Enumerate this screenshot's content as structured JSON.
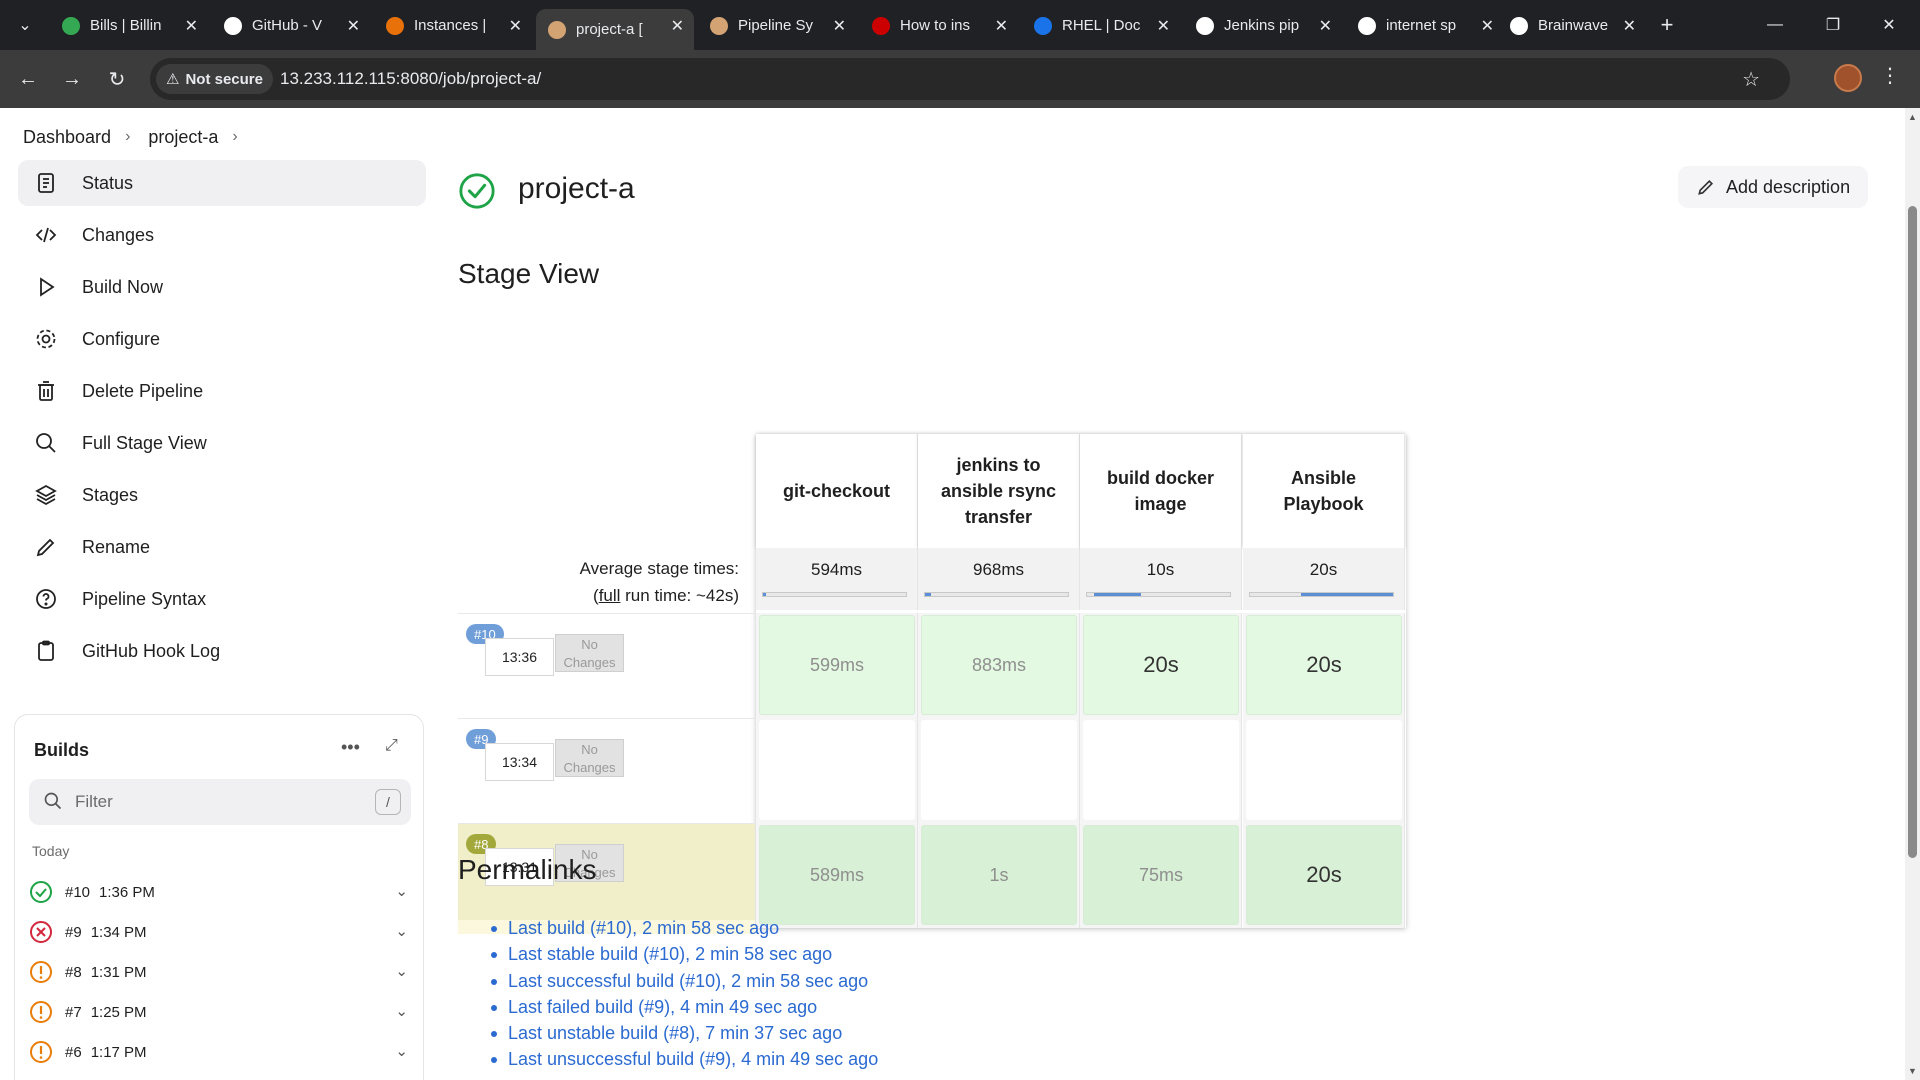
{
  "browser": {
    "tabs": [
      {
        "label": "Bills | Billin",
        "icon": "bills-favicon",
        "color": "#34a853"
      },
      {
        "label": "GitHub - V",
        "icon": "github-favicon",
        "color": "#ffffff"
      },
      {
        "label": "Instances |",
        "icon": "aws-favicon",
        "color": "#e8710a"
      },
      {
        "label": "project-a [",
        "icon": "jenkins-favicon",
        "color": "#d4a373"
      },
      {
        "label": "Pipeline Sy",
        "icon": "jenkins-favicon",
        "color": "#d4a373"
      },
      {
        "label": "How to ins",
        "icon": "redhat-favicon",
        "color": "#cc0000"
      },
      {
        "label": "RHEL | Doc",
        "icon": "rhel-favicon",
        "color": "#1a73e8"
      },
      {
        "label": "Jenkins pip",
        "icon": "openai-favicon",
        "color": "#ffffff"
      },
      {
        "label": "internet sp",
        "icon": "google-favicon",
        "color": "#ffffff"
      },
      {
        "label": "Brainwave",
        "icon": "brainwave-favicon",
        "color": "#ffffff"
      }
    ],
    "active_tab": 3,
    "security_label": "Not secure",
    "url": "13.233.112.115:8080/job/project-a/"
  },
  "breadcrumb": {
    "items": [
      "Dashboard",
      "project-a"
    ]
  },
  "sidebar": {
    "items": [
      {
        "label": "Status",
        "icon": "status-doc-icon"
      },
      {
        "label": "Changes",
        "icon": "code-icon"
      },
      {
        "label": "Build Now",
        "icon": "play-icon"
      },
      {
        "label": "Configure",
        "icon": "gear-icon"
      },
      {
        "label": "Delete Pipeline",
        "icon": "trash-icon"
      },
      {
        "label": "Full Stage View",
        "icon": "search-icon"
      },
      {
        "label": "Stages",
        "icon": "layers-icon"
      },
      {
        "label": "Rename",
        "icon": "pencil-icon"
      },
      {
        "label": "Pipeline Syntax",
        "icon": "help-circle-icon"
      },
      {
        "label": "GitHub Hook Log",
        "icon": "clipboard-icon"
      }
    ]
  },
  "builds": {
    "title": "Builds",
    "filter_placeholder": "Filter",
    "filter_shortcut": "/",
    "group_label": "Today",
    "list": [
      {
        "number": "#10",
        "time": "1:36 PM",
        "status": "success"
      },
      {
        "number": "#9",
        "time": "1:34 PM",
        "status": "failed"
      },
      {
        "number": "#8",
        "time": "1:31 PM",
        "status": "unstable"
      },
      {
        "number": "#7",
        "time": "1:25 PM",
        "status": "unstable"
      },
      {
        "number": "#6",
        "time": "1:17 PM",
        "status": "unstable"
      }
    ]
  },
  "main": {
    "title": "project-a",
    "add_description": "Add description",
    "stage_view_heading": "Stage View",
    "permalinks_heading": "Permalinks"
  },
  "stage_view": {
    "avg_label_line1": "Average stage times:",
    "avg_label_line2_prefix": "(",
    "avg_label_link": "full",
    "avg_label_line2_suffix": " run time: ~42s)",
    "stages": [
      {
        "name": "git-checkout",
        "avg": "594ms",
        "avg_fraction_start": 0.0,
        "avg_fraction": 0.02
      },
      {
        "name": "jenkins to ansible rsync transfer",
        "avg": "968ms",
        "avg_fraction_start": 0.0,
        "avg_fraction": 0.04
      },
      {
        "name": "build docker image",
        "avg": "10s",
        "avg_fraction_start": 0.05,
        "avg_fraction": 0.33
      },
      {
        "name": "Ansible Playbook",
        "avg": "20s",
        "avg_fraction_start": 0.36,
        "avg_fraction": 0.64
      }
    ],
    "runs": [
      {
        "badge": "#10",
        "badge_color": "#6f9ed8",
        "time": "13:36",
        "changes": "No Changes",
        "highlight": false,
        "cells": [
          {
            "text": "599ms",
            "big": false
          },
          {
            "text": "883ms",
            "big": false
          },
          {
            "text": "20s",
            "big": true
          },
          {
            "text": "20s",
            "big": true
          }
        ],
        "cell_color": "#e4f9e1"
      },
      {
        "badge": "#9",
        "badge_color": "#6f9ed8",
        "time": "13:34",
        "changes": "No Changes",
        "highlight": false,
        "cells": [
          {
            "text": "",
            "big": false
          },
          {
            "text": "",
            "big": false
          },
          {
            "text": "",
            "big": false
          },
          {
            "text": "",
            "big": false
          }
        ],
        "cell_color": "#ffffff"
      },
      {
        "badge": "#8",
        "badge_color": "#a3a83a",
        "time": "13:31",
        "changes": "No Changes",
        "highlight": true,
        "cells": [
          {
            "text": "589ms",
            "big": false
          },
          {
            "text": "1s",
            "big": false
          },
          {
            "text": "75ms",
            "big": false
          },
          {
            "text": "20s",
            "big": true
          }
        ],
        "cell_color": "#d8f0d5"
      }
    ]
  },
  "permalinks": [
    "Last build (#10), 2 min 58 sec ago",
    "Last stable build (#10), 2 min 58 sec ago",
    "Last successful build (#10), 2 min 58 sec ago",
    "Last failed build (#9), 4 min 49 sec ago",
    "Last unstable build (#8), 7 min 37 sec ago",
    "Last unsuccessful build (#9), 4 min 49 sec ago"
  ]
}
